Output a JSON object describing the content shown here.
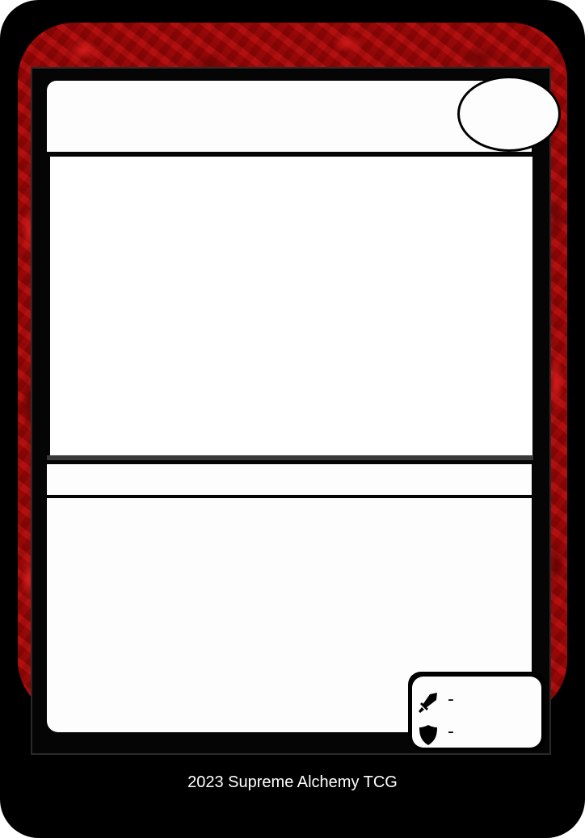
{
  "card": {
    "title": "",
    "cost": "",
    "type_line": "",
    "rules_text": "",
    "stats": {
      "attack_icon": "sword-icon",
      "attack_value": "-",
      "defense_icon": "shield-icon",
      "defense_value": "-"
    },
    "colors": {
      "border_art": "#a00a0a",
      "frame": "#000000",
      "panel": "#fdfdfd"
    }
  },
  "footer": {
    "credit": "2023 Supreme Alchemy TCG"
  }
}
